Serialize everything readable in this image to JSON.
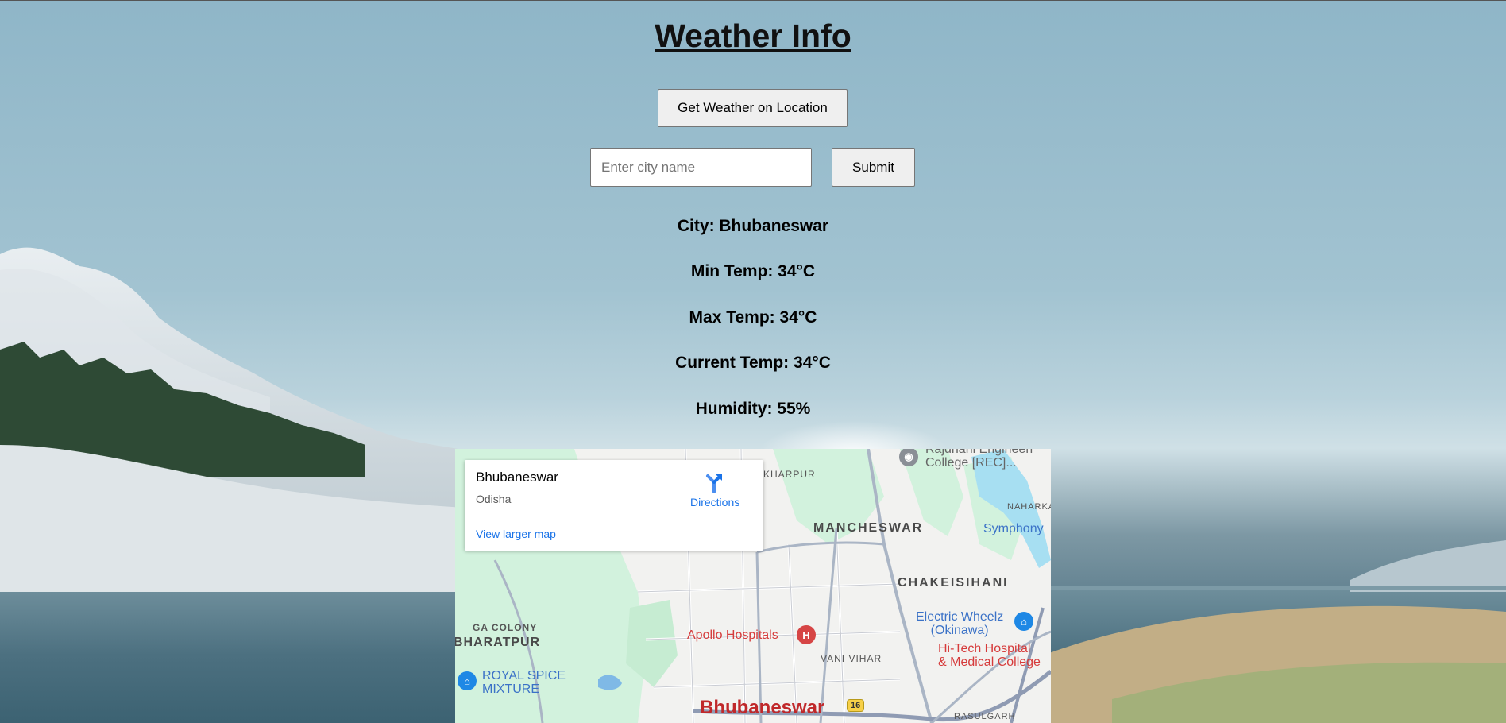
{
  "page": {
    "title": "Weather Info",
    "location_button": "Get Weather on Location",
    "city_input": {
      "placeholder": "Enter city name",
      "value": ""
    },
    "submit_button": "Submit"
  },
  "weather": {
    "city": "City: Bhubaneswar",
    "min_temp": "Min Temp: 34°C",
    "max_temp": "Max Temp: 34°C",
    "current_temp": "Current Temp: 34°C",
    "humidity": "Humidity: 55%"
  },
  "map": {
    "card": {
      "place": "Bhubaneswar",
      "region": "Odisha",
      "directions": "Directions",
      "larger_map": "View larger map"
    },
    "labels": {
      "rajdhani": "Rajdhani Engineeri\nCollege [REC]...",
      "kharpur": "KHARPUR",
      "naharka": "NAHARKA",
      "mancheswar": "MANCHESWAR",
      "symphony": "Symphony",
      "chakeisihani": "CHAKEISIHANI",
      "electric": "Electric Wheelz\n(Okinawa)",
      "ga_colony": "GA COLONY",
      "bharatpur": "BHARATPUR",
      "apollo": "Apollo Hospitals",
      "hitech": "Hi-Tech Hospital\n& Medical College",
      "vani_vihar": "VANI VIHAR",
      "royal_spice": "ROYAL SPICE\nMIXTURE",
      "city": "Bhubaneswar",
      "highway": "16",
      "rasulgarh": "RASULGARH"
    },
    "icons": {
      "hospital": "H",
      "shop": "bag",
      "college": "cap"
    }
  },
  "colors": {
    "link": "#1a73e8",
    "city_label": "#c0282a",
    "poi_red": "#d63b3b",
    "poi_blue": "#3b72c7"
  }
}
